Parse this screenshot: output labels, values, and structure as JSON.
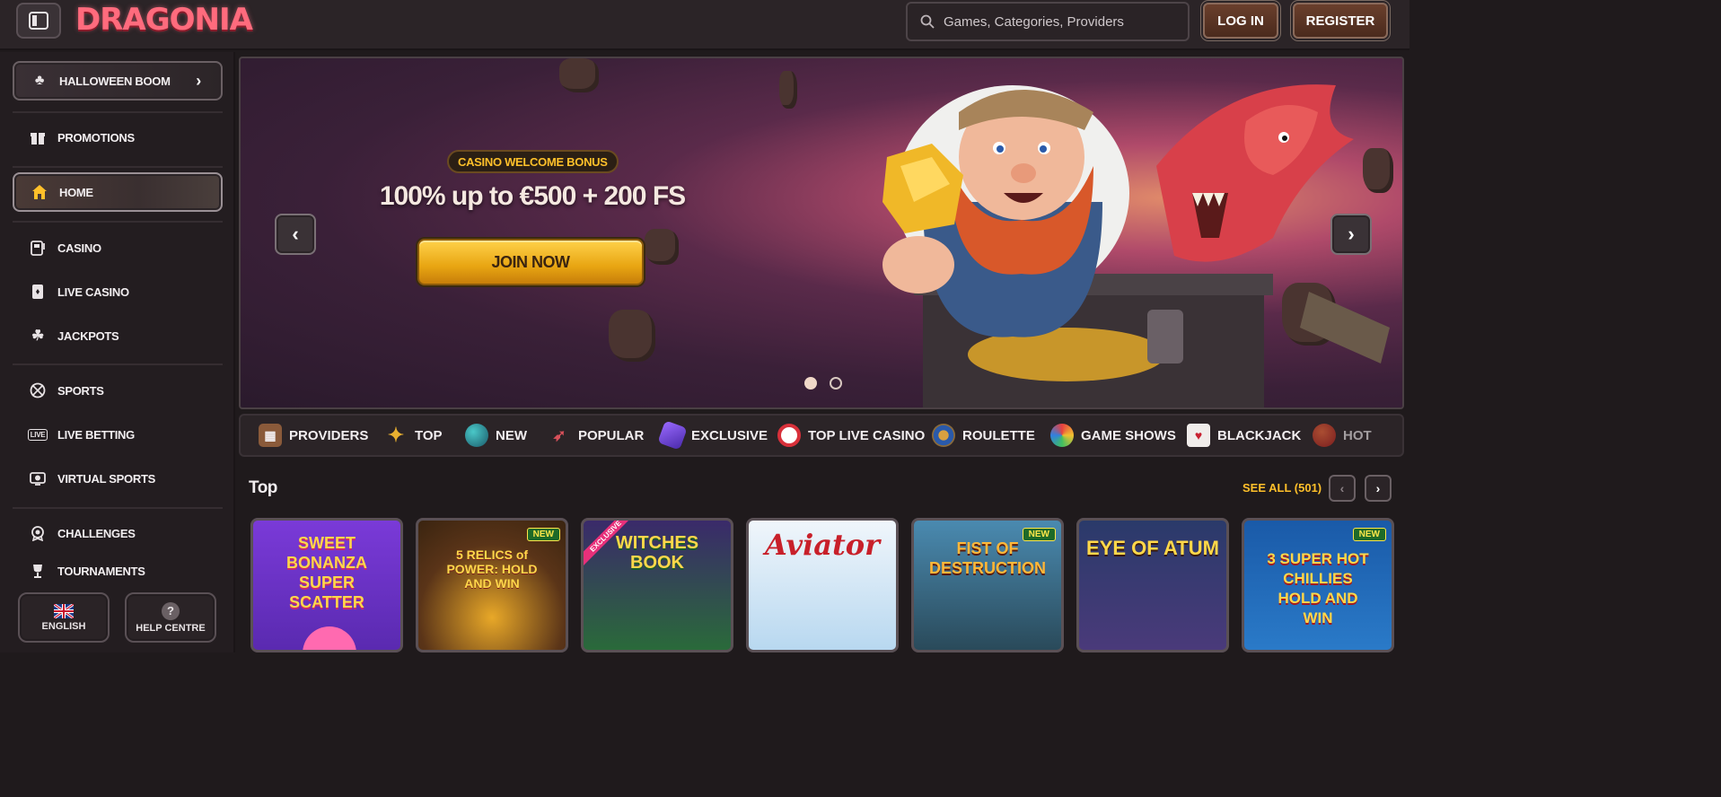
{
  "header": {
    "logo": "DRAGONIA",
    "search_placeholder": "Games, Categories, Providers",
    "login_label": "LOG IN",
    "register_label": "REGISTER"
  },
  "sidebar": {
    "items": [
      {
        "label": "HALLOWEEN BOOM",
        "icon": "bat-icon"
      },
      {
        "label": "PROMOTIONS",
        "icon": "gift-icon"
      },
      {
        "label": "HOME",
        "icon": "home-icon"
      },
      {
        "label": "CASINO",
        "icon": "slot-machine-icon"
      },
      {
        "label": "LIVE CASINO",
        "icon": "cards-icon"
      },
      {
        "label": "JACKPOTS",
        "icon": "clover-icon"
      },
      {
        "label": "SPORTS",
        "icon": "ball-icon"
      },
      {
        "label": "LIVE BETTING",
        "icon": "live-icon"
      },
      {
        "label": "VIRTUAL SPORTS",
        "icon": "virtual-icon"
      },
      {
        "label": "CHALLENGES",
        "icon": "medal-icon"
      },
      {
        "label": "TOURNAMENTS",
        "icon": "trophy-icon"
      }
    ],
    "language_label": "ENGLISH",
    "help_label": "HELP CENTRE"
  },
  "hero": {
    "badge": "CASINO WELCOME BONUS",
    "title": "100% up to €500 + 200 FS",
    "cta": "JOIN NOW",
    "slides": 2,
    "active_slide": 1
  },
  "categories": [
    "PROVIDERS",
    "TOP",
    "NEW",
    "POPULAR",
    "EXCLUSIVE",
    "TOP LIVE CASINO",
    "ROULETTE",
    "GAME SHOWS",
    "BLACKJACK",
    "HOT"
  ],
  "section": {
    "title": "Top",
    "see_all": "SEE ALL (501)"
  },
  "games": [
    {
      "title": "SWEET BONANZA SUPER SCATTER",
      "badge": ""
    },
    {
      "title": "5 RELICS of POWER: HOLD AND WIN",
      "badge": "NEW"
    },
    {
      "title": "WITCHES BOOK",
      "badge": "EXCLUSIVE"
    },
    {
      "title": "Aviator",
      "badge": ""
    },
    {
      "title": "FIST OF DESTRUCTION",
      "badge": "NEW"
    },
    {
      "title": "EYE OF ATUM",
      "badge": ""
    },
    {
      "title": "3 SUPER HOT CHILLIES HOLD AND WIN",
      "badge": "NEW"
    }
  ],
  "colors": {
    "accent": "#ffc02a",
    "background": "#1f1a1c",
    "brand": "#ff6b7d"
  }
}
